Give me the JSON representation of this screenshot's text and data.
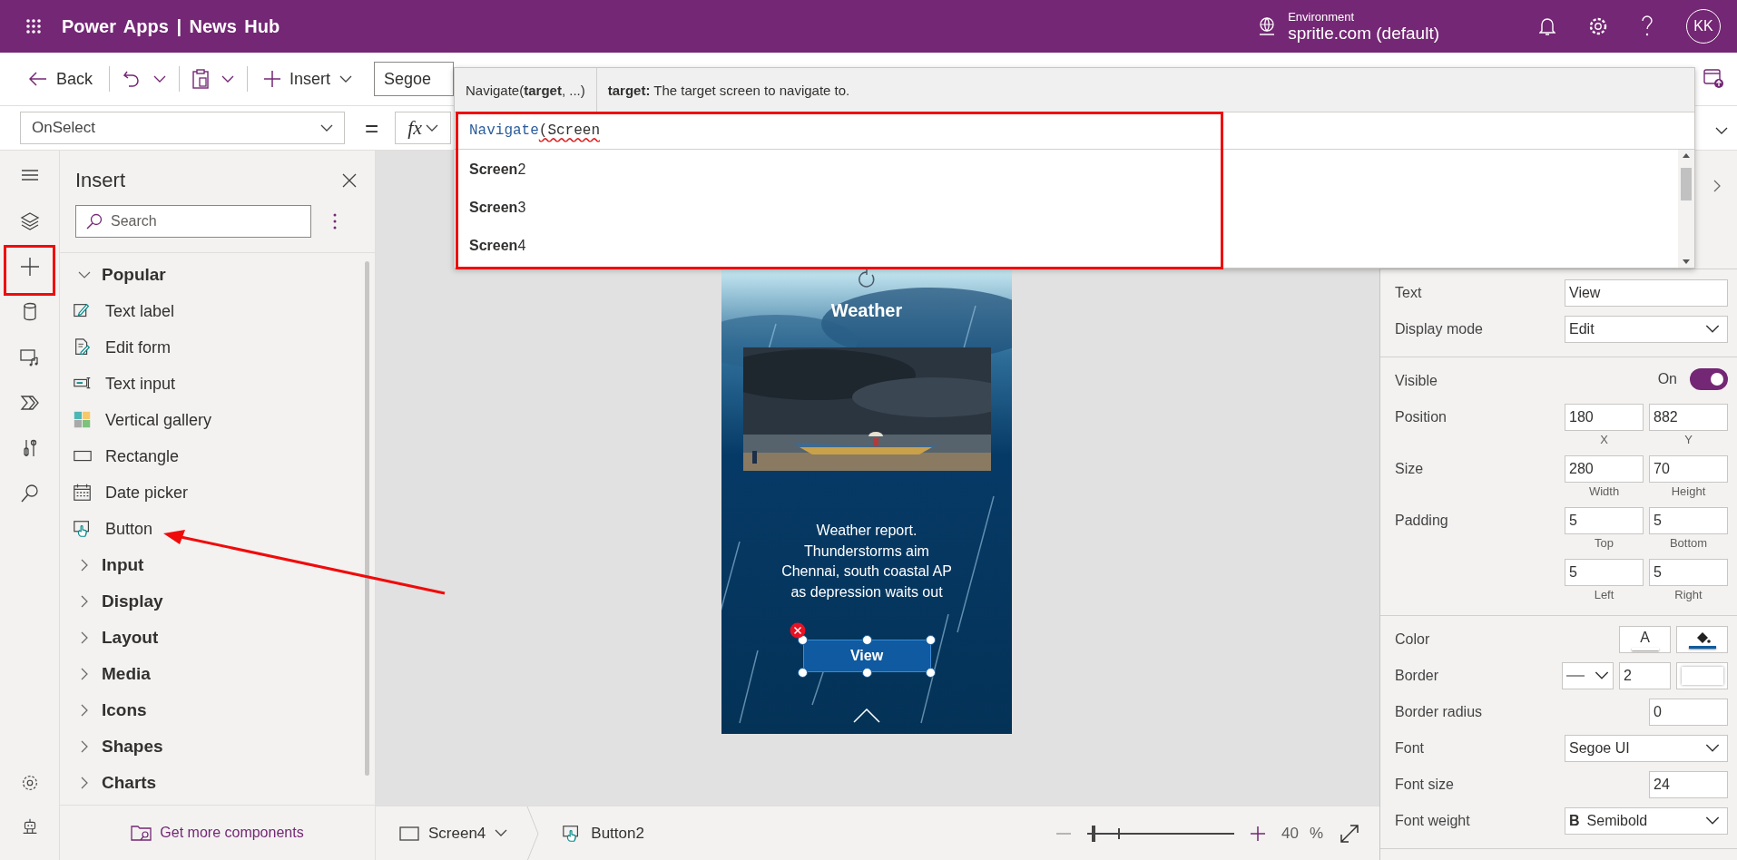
{
  "header": {
    "title": "Power Apps | News Hub",
    "environment_label": "Environment",
    "environment_value": "spritle.com (default)",
    "avatar": "KK"
  },
  "toolbar": {
    "back": "Back",
    "insert": "Insert",
    "font": "Segoe"
  },
  "formula_bar": {
    "property": "OnSelect",
    "equals": "=",
    "fx": "fx"
  },
  "autocomplete": {
    "signature": "Navigate(**target**, ...)",
    "hint": "**target:** The target screen to navigate to.",
    "formula": {
      "function": "Navigate",
      "arguments": "(Screen"
    },
    "suggestions": [
      "**Screen**2",
      "**Screen**3",
      "**Screen**4"
    ]
  },
  "insert_panel": {
    "title": "Insert",
    "search": {
      "placeholder": "Search"
    },
    "categories": [
      {
        "label": "Popular",
        "expanded": true,
        "children": [
          "Text label",
          "Edit form",
          "Text input",
          "Vertical gallery",
          "Rectangle",
          "Date picker",
          "Button"
        ]
      },
      {
        "label": "Input",
        "expanded": false
      },
      {
        "label": "Display",
        "expanded": false
      },
      {
        "label": "Layout",
        "expanded": false
      },
      {
        "label": "Media",
        "expanded": false
      },
      {
        "label": "Icons",
        "expanded": false
      },
      {
        "label": "Shapes",
        "expanded": false
      },
      {
        "label": "Charts",
        "expanded": false
      }
    ],
    "footer_link": "Get more components"
  },
  "canvas": {
    "screen_title": "Weather",
    "article": "Weather report. Thunderstorms aim Chennai, south coastal AP as depression waits out",
    "button": "View"
  },
  "bottom_bar": {
    "screen": "Screen4",
    "control": "Button2",
    "zoom": {
      "level": 0.03,
      "value": "40",
      "unit": "%"
    }
  },
  "properties": [
    {
      "rows": [
        {
          "kind": "text",
          "label": "Text",
          "value": "View"
        },
        {
          "kind": "dropdown",
          "label": "Display mode",
          "value": "Edit"
        }
      ]
    },
    {
      "rows": [
        {
          "kind": "toggle",
          "label": "Visible",
          "state_label": "On",
          "on": true
        },
        {
          "kind": "fields",
          "label": "Position",
          "fields": [
            {
              "value": "180",
              "caption": "X"
            },
            {
              "value": "882",
              "caption": "Y"
            }
          ]
        },
        {
          "kind": "fields",
          "label": "Size",
          "fields": [
            {
              "value": "280",
              "caption": "Width"
            },
            {
              "value": "70",
              "caption": "Height"
            }
          ]
        },
        {
          "kind": "fields",
          "label": "Padding",
          "fields": [
            {
              "value": "5",
              "caption": "Top"
            },
            {
              "value": "5",
              "caption": "Bottom"
            },
            {
              "value": "5",
              "caption": "Left"
            },
            {
              "value": "5",
              "caption": "Right"
            }
          ]
        }
      ]
    },
    {
      "rows": [
        {
          "kind": "colors",
          "label": "Color",
          "swatches": [
            {
              "kind": "text",
              "sample": "A",
              "color": "#ffffff"
            },
            {
              "kind": "fill",
              "color": "#0f5aa0"
            }
          ]
        },
        {
          "kind": "border",
          "label": "Border",
          "value": "2",
          "color": "#ffffff"
        },
        {
          "kind": "number",
          "label": "Border radius",
          "value": "0"
        },
        {
          "kind": "dropdown",
          "label": "Font",
          "value": "Segoe UI"
        },
        {
          "kind": "number",
          "label": "Font size",
          "value": "24"
        },
        {
          "kind": "dropdown",
          "label": "Font weight",
          "prefix": "B",
          "value": "Semibold"
        }
      ]
    }
  ]
}
